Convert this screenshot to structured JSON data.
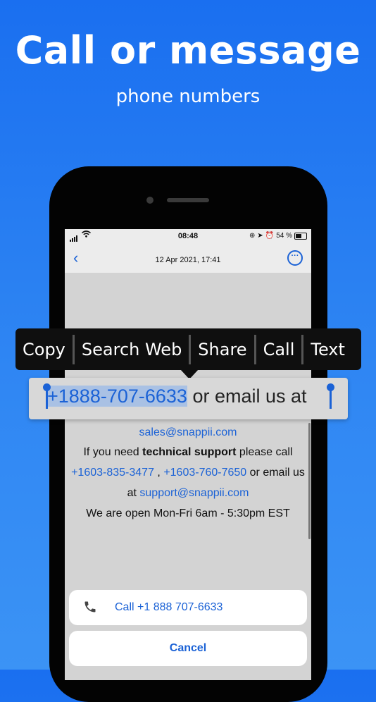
{
  "promo": {
    "headline": "Call or message",
    "subhead": "phone numbers"
  },
  "status_bar": {
    "time": "08:48",
    "battery": "54 %"
  },
  "nav": {
    "back_icon": "chevron-left-icon",
    "title": "12 Apr 2021, 17:41",
    "more_icon": "ellipsis-circle-icon"
  },
  "context_menu": {
    "items": [
      "Copy",
      "Search Web",
      "Share",
      "Call",
      "Text"
    ]
  },
  "magnifier": {
    "selected": "+1888-707-6633",
    "rest": " or email us at"
  },
  "message": {
    "sales_email": "sales@snappii.com",
    "line2_a": "If you need ",
    "line2_bold": "technical support",
    "line2_b": " please call",
    "phone2": "+1603-835-3477",
    "comma": " , ",
    "phone3": "+1603-760-7650",
    "line3_tail": " or email us",
    "at": "at ",
    "support_email": "support@snappii.com",
    "hours": "We are open Mon-Fri 6am - 5:30pm EST"
  },
  "action_sheet": {
    "call_label": "Call +1 888 707-6633",
    "cancel_label": "Cancel"
  },
  "colors": {
    "accent": "#1b62d6",
    "background_top": "#1a6ff0",
    "background_bottom": "#3b93f5"
  }
}
